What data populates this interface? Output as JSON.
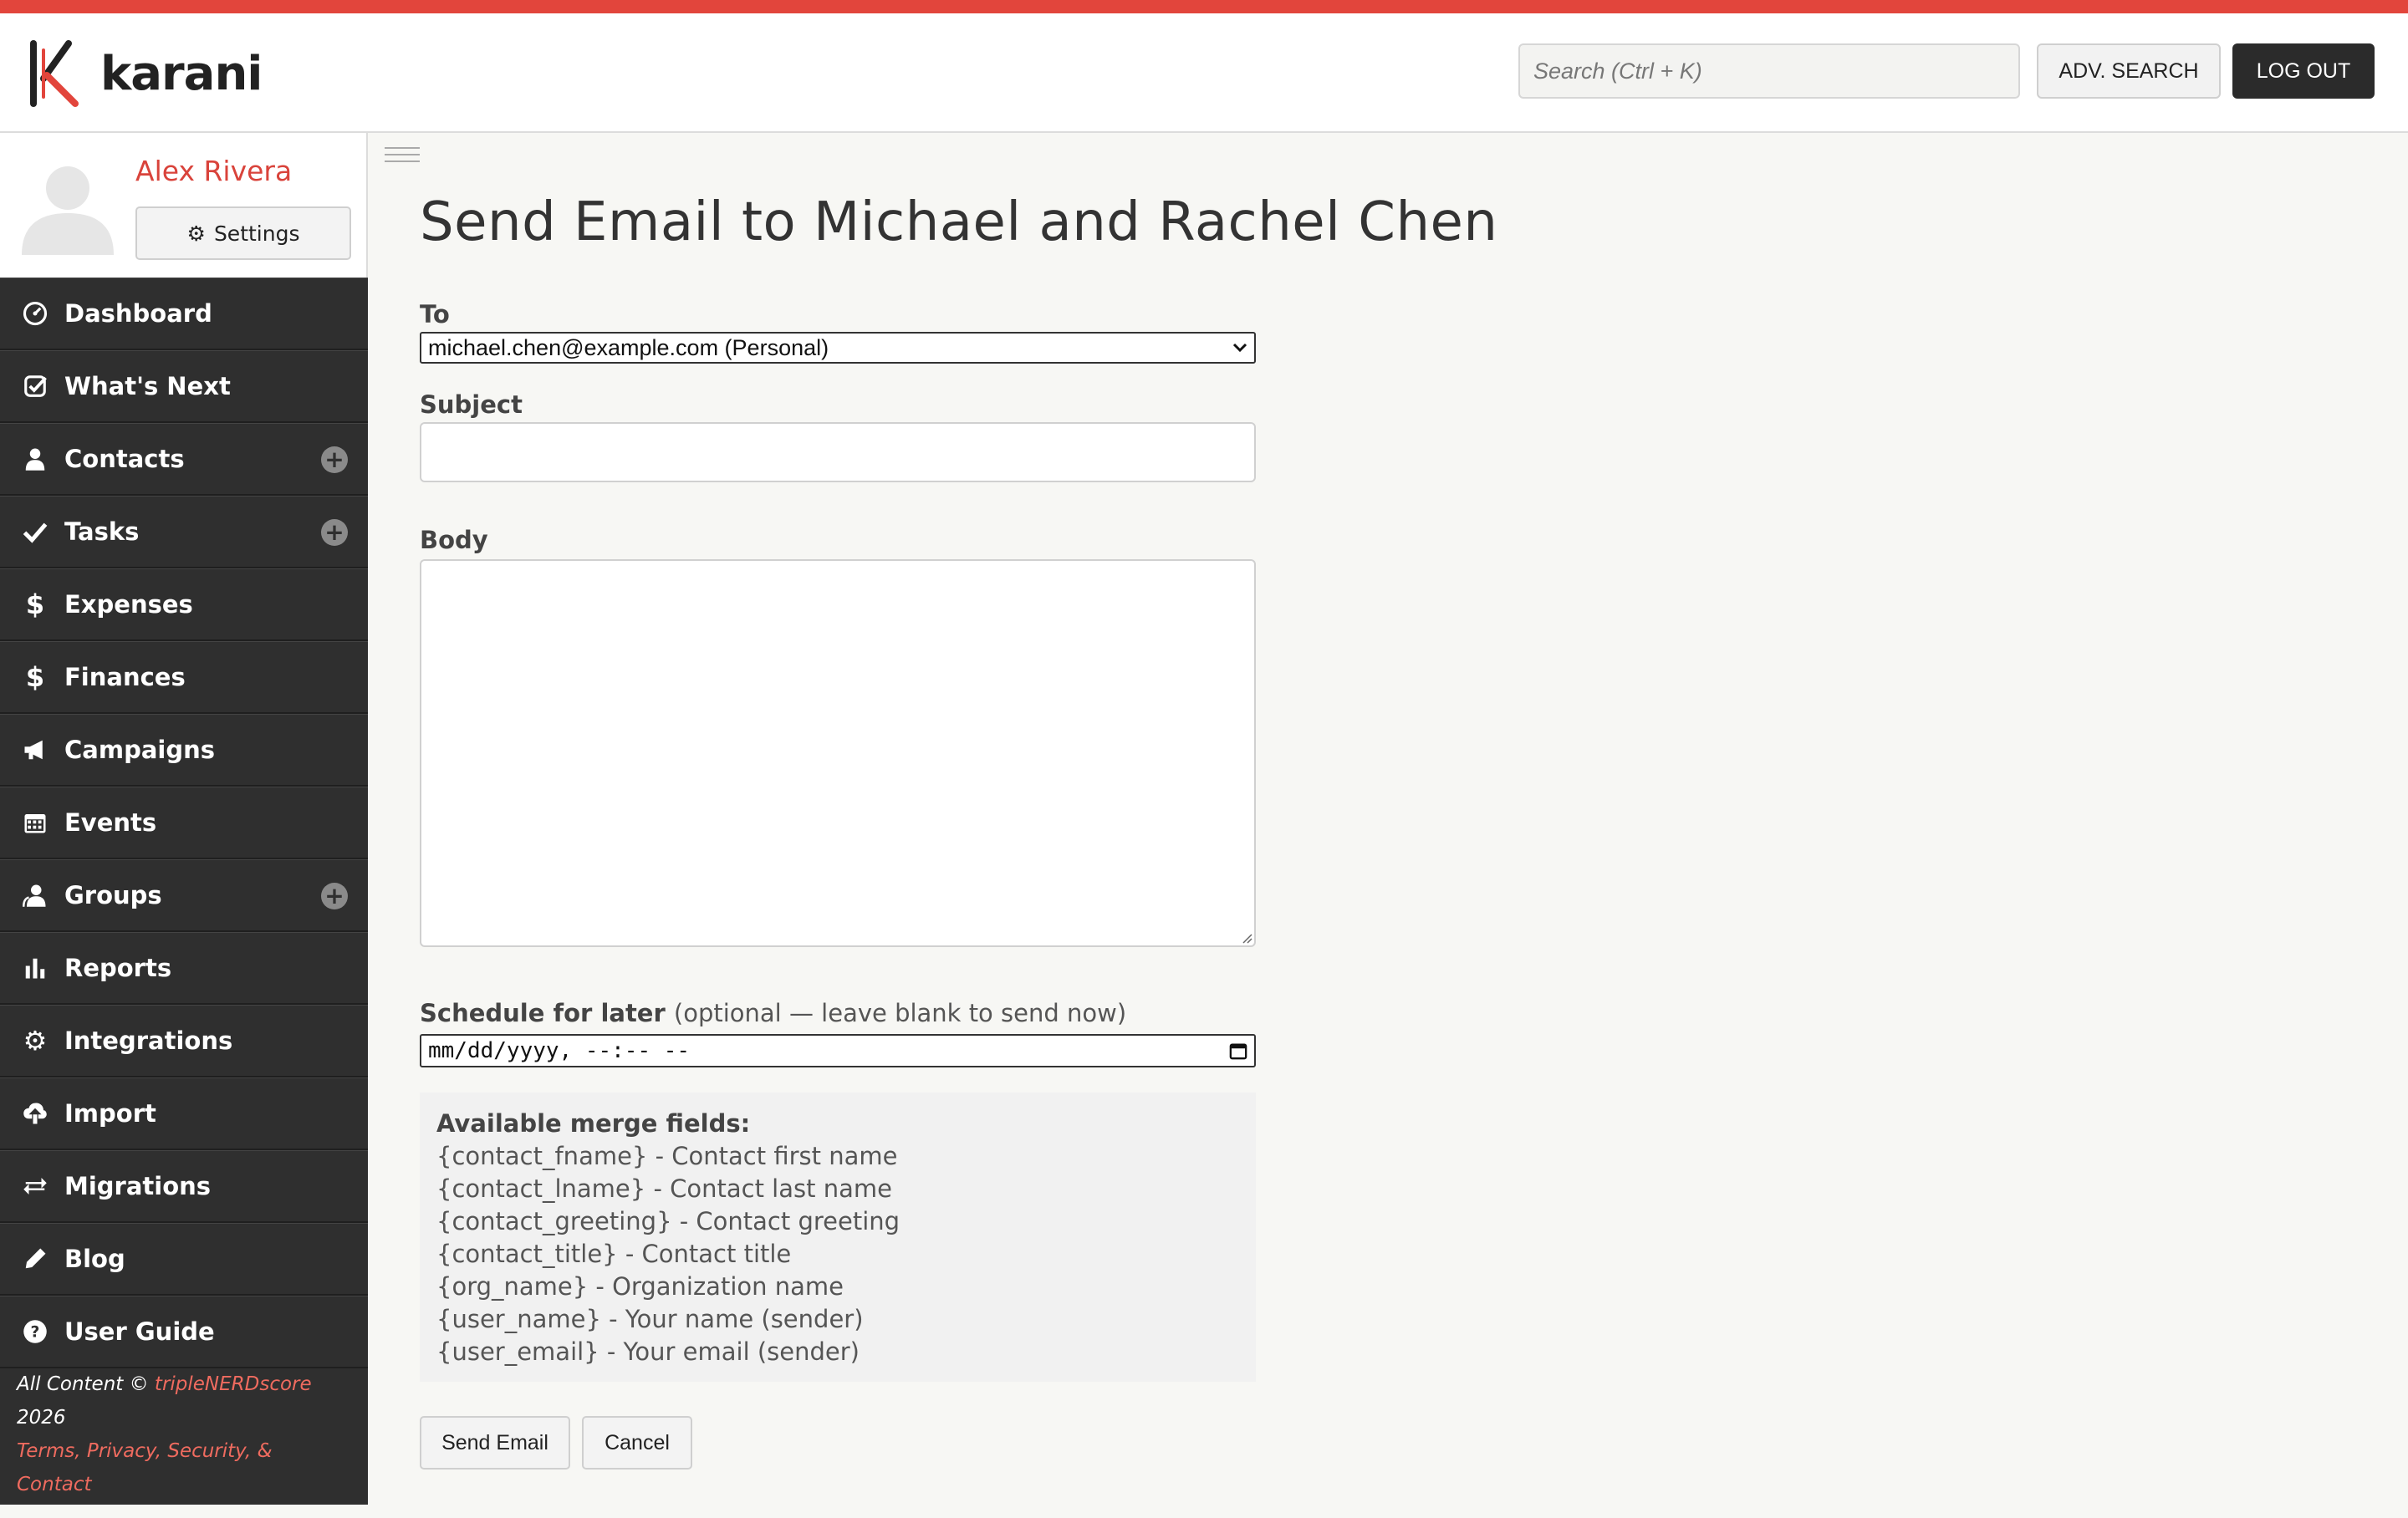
{
  "app": {
    "name": "karani"
  },
  "header": {
    "search_placeholder": "Search (Ctrl + K)",
    "adv_search_label": "ADV. SEARCH",
    "logout_label": "LOG OUT"
  },
  "profile": {
    "name": "Alex Rivera",
    "settings_label": "Settings"
  },
  "sidebar": {
    "items": [
      {
        "label": "Dashboard",
        "icon": "dashboard-icon",
        "plus": false
      },
      {
        "label": "What's Next",
        "icon": "check-square-icon",
        "plus": false
      },
      {
        "label": "Contacts",
        "icon": "user-icon",
        "plus": true
      },
      {
        "label": "Tasks",
        "icon": "check-icon",
        "plus": true
      },
      {
        "label": "Expenses",
        "icon": "dollar-icon",
        "plus": false
      },
      {
        "label": "Finances",
        "icon": "dollar-icon",
        "plus": false
      },
      {
        "label": "Campaigns",
        "icon": "bullhorn-icon",
        "plus": false
      },
      {
        "label": "Events",
        "icon": "calendar-icon",
        "plus": false
      },
      {
        "label": "Groups",
        "icon": "users-icon",
        "plus": true
      },
      {
        "label": "Reports",
        "icon": "bar-chart-icon",
        "plus": false
      },
      {
        "label": "Integrations",
        "icon": "gear-icon",
        "plus": false
      },
      {
        "label": "Import",
        "icon": "cloud-upload-icon",
        "plus": false
      },
      {
        "label": "Migrations",
        "icon": "exchange-icon",
        "plus": false
      },
      {
        "label": "Blog",
        "icon": "pencil-icon",
        "plus": false
      },
      {
        "label": "User Guide",
        "icon": "question-icon",
        "plus": false
      }
    ]
  },
  "footer": {
    "copyright_prefix": "All Content ©",
    "brand": "tripleNERDscore",
    "year": "2026",
    "links_label": "Terms, Privacy, Security, & Contact"
  },
  "main": {
    "title": "Send Email to Michael and Rachel Chen",
    "to_label": "To",
    "to_value": "michael.chen@example.com (Personal)",
    "subject_label": "Subject",
    "subject_value": "",
    "body_label": "Body",
    "body_value": "",
    "schedule_label": "Schedule for later",
    "schedule_optional": "(optional — leave blank to send now)",
    "schedule_placeholder": "mm/dd/yyyy, --:-- --",
    "merge_title": "Available merge fields:",
    "merge_fields": [
      "{contact_fname} - Contact first name",
      "{contact_lname} - Contact last name",
      "{contact_greeting} - Contact greeting",
      "{contact_title} - Contact title",
      "{org_name} - Organization name",
      "{user_name} - Your name (sender)",
      "{user_email} - Your email (sender)"
    ],
    "send_label": "Send Email",
    "cancel_label": "Cancel"
  },
  "colors": {
    "accent": "#e2453c",
    "sidebar_bg": "#2f2f2f",
    "link": "#ef6b5f"
  }
}
